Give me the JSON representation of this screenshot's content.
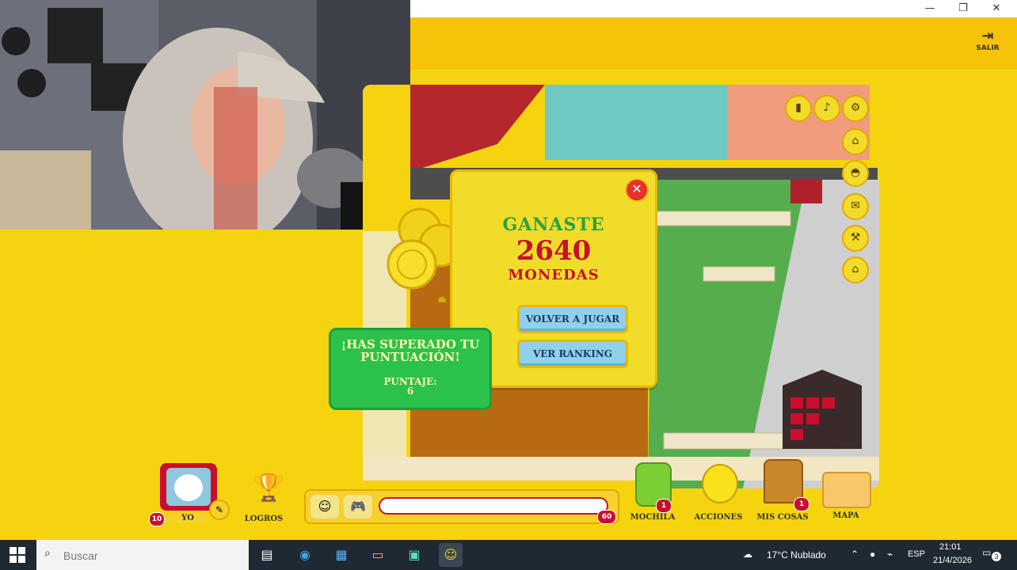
{
  "window": {
    "minimize_label": "—",
    "maximize_label": "❐",
    "close_label": "✕"
  },
  "header": {
    "exit_label": "SALIR",
    "exit_icon": "logout-icon"
  },
  "win_popup": {
    "title": "GANASTE",
    "amount": "2640",
    "unit": "MONEDAS",
    "play_again_label": "VOLVER A JUGAR",
    "ranking_label": "VER RANKING",
    "close_label": "✕"
  },
  "score_popup": {
    "message": "¡HAS SUPERADO TU PUNTUACIÓN!",
    "score_label": "PUNTAJE:",
    "score_value": "6"
  },
  "side_icons": [
    "stats-icon",
    "music-icon",
    "gear-icon",
    "house-icon",
    "hat-icon",
    "mail-icon",
    "hammer-icon",
    "map-house-icon"
  ],
  "toolbar": {
    "me_label": "YO",
    "me_level": "10",
    "achievements_label": "LOGROS",
    "chat_count": "60",
    "backpack_label": "MOCHILA",
    "backpack_badge": "1",
    "actions_label": "ACCIONES",
    "my_things_label": "MIS COSAS",
    "my_things_badge": "1",
    "map_label": "MAPA"
  },
  "taskbar": {
    "search_placeholder": "Buscar",
    "weather": "17°C  Nublado",
    "language": "ESP",
    "time": "21:01",
    "date": "21/4/2026",
    "notifications": "3"
  },
  "colors": {
    "accent": "#f5d40f",
    "header": "#f7c20a",
    "win_green": "#2aa142",
    "win_red": "#c8102e",
    "button_blue": "#8fd0ea",
    "score_green": "#2cc14b"
  }
}
